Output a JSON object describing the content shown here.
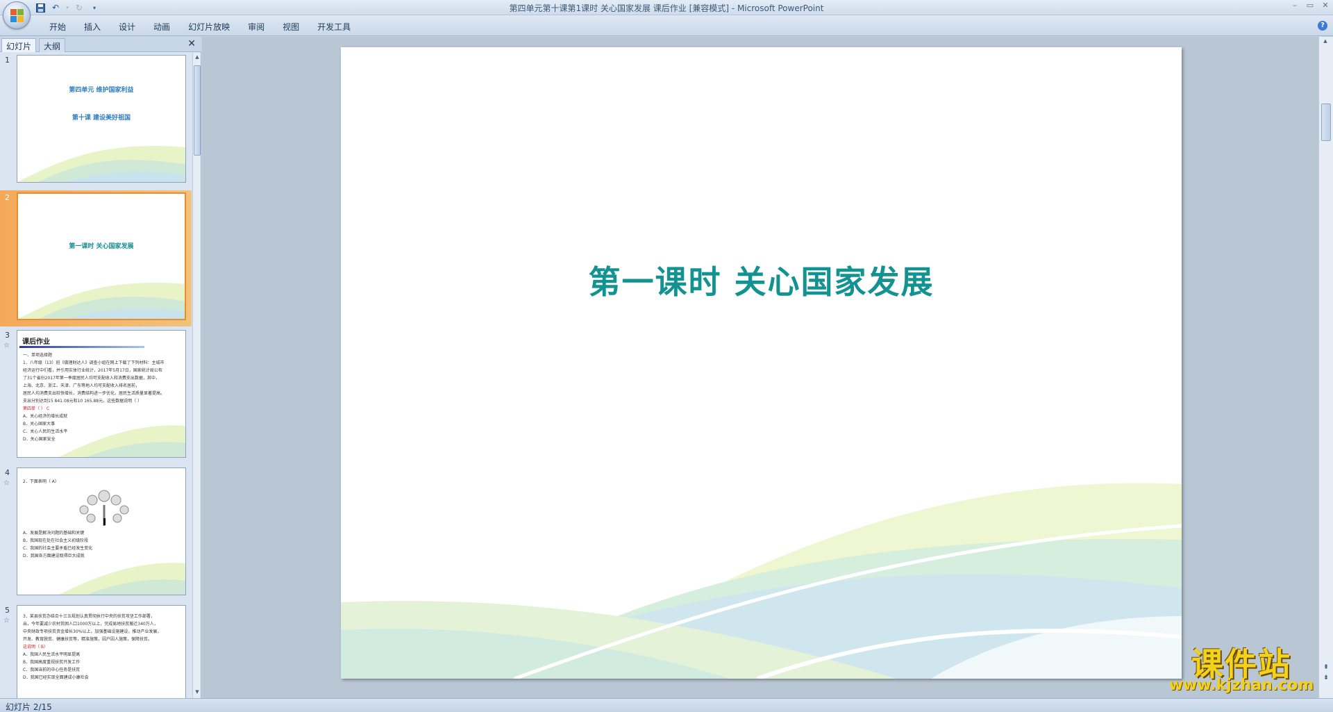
{
  "window": {
    "title": "第四单元第十课第1课时 关心国家发展 课后作业 [兼容模式] - Microsoft PowerPoint"
  },
  "ribbon": {
    "tabs": [
      "开始",
      "插入",
      "设计",
      "动画",
      "幻灯片放映",
      "审阅",
      "视图",
      "开发工具"
    ]
  },
  "panel": {
    "tab_slides": "幻灯片",
    "tab_outline": "大纲"
  },
  "thumbnails": [
    {
      "number": "1",
      "line1": "第四单元  维护国家利益",
      "line2": "第十课   建设美好祖国"
    },
    {
      "number": "2",
      "line1": "第一课时    关心国家发展"
    },
    {
      "number": "3",
      "header": "课后作业",
      "lines": [
        "一、单项选择题",
        "1．八年级（13）班《做理财达人》调查小组在网上下载了下列材料：主城市",
        "经济运行中们看，并引用实体行业统计，2017年5月17日，国家统计局公布",
        "了31个省份2017年第一季度居民人均可支配收入和消费支出数据，其中，",
        "上海、北京、浙江、天津、广东等地人均可支配收入排名居前，",
        "居民人均消费支出较快增长，消费结构进一步优化，居民生活质量显著提高。",
        "支出分别达到15 841.08元和10 165.88元。这些数据说明（  ）",
        "第四单（  ）  C"
      ],
      "options": [
        "A．关心经济的增长成就",
        "B．关心国家大事",
        "C．关心人民的生活水平",
        "D．关心国家安全"
      ]
    },
    {
      "number": "4",
      "question": "2．下面表明（  A）",
      "options": [
        "A．发展是解决问题的基础和关键",
        "B．我国现在处在社会主义初级阶段",
        "C．我国的社会主要矛盾已经发生变化",
        "D．我国各方面建设取得巨大成就"
      ]
    },
    {
      "number": "5",
      "lines": [
        "3．某县扶贫办结合十三五规划认真贯彻执行中央的扶贫攻坚工作部署，",
        "出，今年要减少农村贫困人口1000万以上，完成易地扶贫搬迁340万人，",
        "中央财政专项扶贫资金增长30%以上，加强基础设施建设，推动产业发展，",
        "开发、教育脱贫、健康扶贫等，精准施策，因户因人施策，保障扶贫。",
        "这说明（  B）"
      ],
      "options": [
        "A．我国人民生活水平明显提高",
        "B．我国高度重视扶贫开发工作",
        "C．我国当前的中心任务是扶贫",
        "D．我国已经实现全面建成小康社会"
      ]
    }
  ],
  "slide": {
    "title": "第一课时    关心国家发展"
  },
  "status": {
    "slide_indicator": "幻灯片 2/15"
  },
  "watermark": {
    "main": "课件站",
    "url": "www.kjzhan.com"
  },
  "colors": {
    "title_teal": "#139292",
    "thumb_blue": "#2f7ec0",
    "selection_orange": "#e98d2e"
  }
}
